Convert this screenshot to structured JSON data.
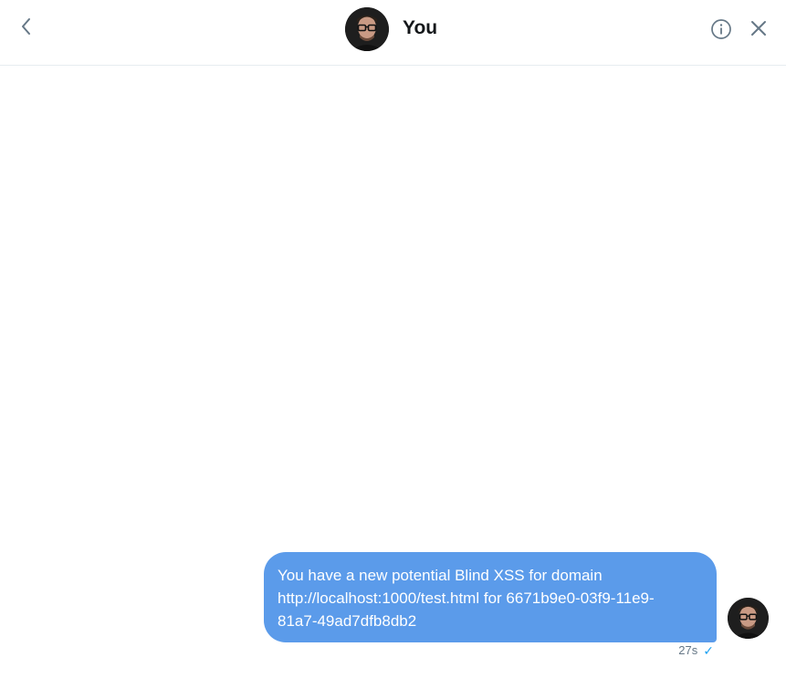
{
  "header": {
    "title": "You",
    "back_icon": "chevron-left-icon",
    "info_icon": "info-icon",
    "close_icon": "close-icon"
  },
  "messages": [
    {
      "lines": [
        "You have a new potential Blind XSS for domain",
        "http://localhost:1000/test.html for 6671b9e0-03f9-11e9-",
        "81a7-49ad7dfb8db2"
      ],
      "timestamp": "27s",
      "status_icon": "checkmark-icon"
    }
  ],
  "colors": {
    "bubble": "#5b9bea",
    "accent": "#1da1f2",
    "text_primary": "#14171a",
    "text_secondary": "#657786",
    "divider": "#e6ecf0"
  }
}
